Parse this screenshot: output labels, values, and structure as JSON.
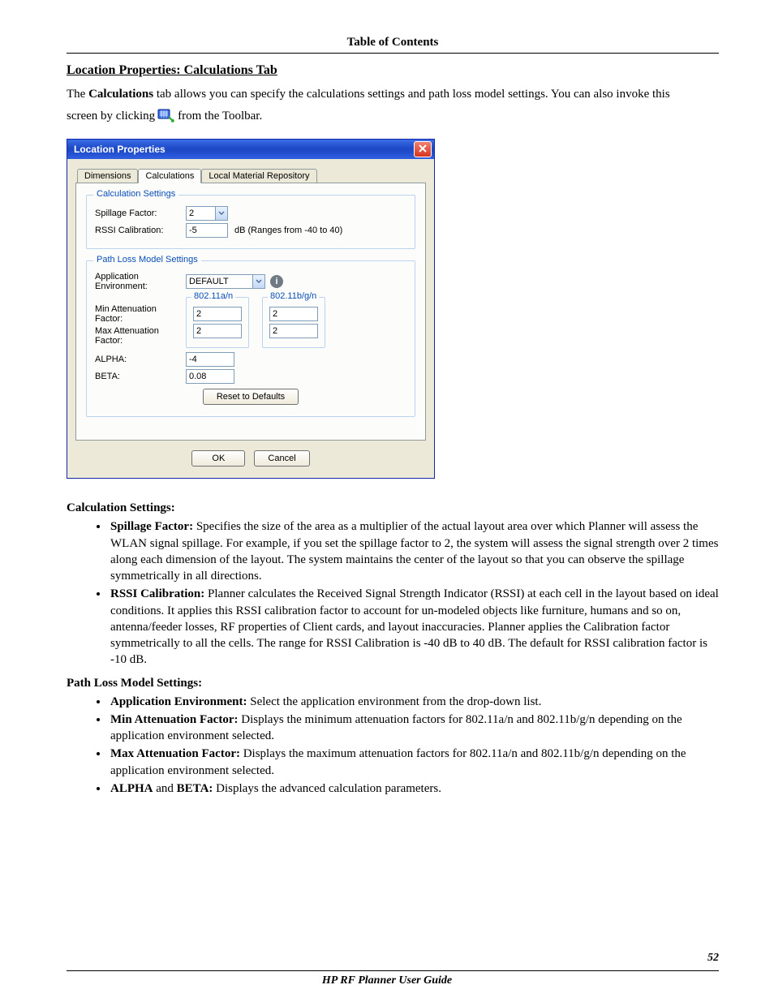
{
  "header": {
    "toc": "Table of Contents"
  },
  "section": {
    "title": "Location Properties: Calculations Tab",
    "intro_leading": "The ",
    "intro_bold": "Calculations",
    "intro_trailing": " tab allows you can specify the calculations settings and path loss model settings. You can also invoke this",
    "intro_line2_leading": "screen by clicking ",
    "intro_line2_trailing": " from the Toolbar."
  },
  "dialog": {
    "title": "Location Properties",
    "tabs": {
      "dimensions": "Dimensions",
      "calculations": "Calculations",
      "local_repo": "Local Material Repository"
    },
    "calc_settings": {
      "legend": "Calculation Settings",
      "spillage_label": "Spillage Factor:",
      "spillage_value": "2",
      "rssi_label": "RSSI Calibration:",
      "rssi_value": "-5",
      "rssi_hint": "dB (Ranges from -40 to 40)"
    },
    "path_loss": {
      "legend": "Path Loss Model Settings",
      "env_label": "Application Environment:",
      "env_value": "DEFAULT",
      "sub_a_label": "802.11a/n",
      "sub_b_label": "802.11b/g/n",
      "min_label": "Min Attenuation Factor:",
      "max_label": "Max Attenuation Factor:",
      "min_a": "2",
      "min_b": "2",
      "max_a": "2",
      "max_b": "2",
      "alpha_label": "ALPHA:",
      "alpha_value": "-4",
      "beta_label": "BETA:",
      "beta_value": "0.08",
      "reset_label": "Reset to Defaults"
    },
    "ok_label": "OK",
    "cancel_label": "Cancel"
  },
  "desc": {
    "calc_heading": "Calculation Settings:",
    "spillage_bold": "Spillage Factor:",
    "spillage_text": " Specifies the size of the area as a multiplier of the actual layout area over which Planner will assess the WLAN signal spillage. For example, if you set the spillage factor to 2, the system will assess the signal strength over 2 times along each dimension of the layout. The system maintains the center of the layout so that you can observe the spillage symmetrically in all directions.",
    "rssi_bold": "RSSI Calibration:",
    "rssi_text": " Planner calculates the Received Signal Strength Indicator (RSSI) at each cell in the layout based on ideal conditions. It applies this RSSI calibration factor to account for un-modeled objects like furniture, humans and so on, antenna/feeder losses, RF properties of Client cards, and layout inaccuracies. Planner applies the Calibration factor symmetrically to all the cells. The range for RSSI Calibration is -40 dB to 40 dB. The default for RSSI calibration factor is -10 dB.",
    "path_heading": "Path Loss Model Settings:",
    "env_bold": "Application Environment:",
    "env_text": " Select the application environment from the drop-down list.",
    "min_bold": "Min Attenuation Factor:",
    "min_text": " Displays the minimum attenuation factors for 802.11a/n and 802.11b/g/n depending on the application environment selected.",
    "max_bold": "Max Attenuation Factor:",
    "max_text": " Displays the maximum attenuation factors for 802.11a/n and 802.11b/g/n depending on the application environment selected.",
    "ab_bold1": "ALPHA",
    "ab_mid": " and ",
    "ab_bold2": "BETA:",
    "ab_text": " Displays the advanced calculation parameters."
  },
  "footer": {
    "page_num": "52",
    "guide": "HP RF Planner User Guide"
  }
}
